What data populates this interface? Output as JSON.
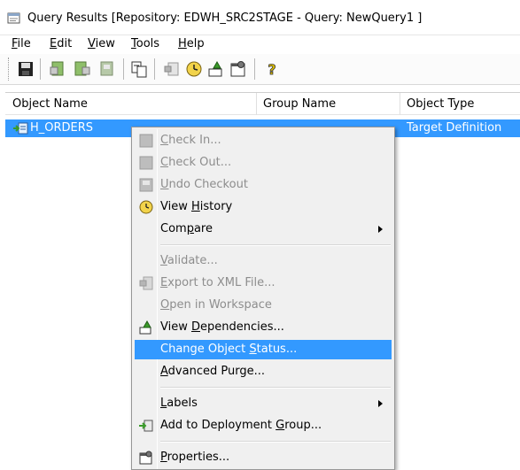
{
  "window": {
    "title": "Query Results [Repository: EDWH_SRC2STAGE - Query: NewQuery1 ]"
  },
  "menubar": {
    "items": [
      {
        "label": "File",
        "mnemonic": "F",
        "rest": "ile"
      },
      {
        "label": "Edit",
        "mnemonic": "E",
        "rest": "dit"
      },
      {
        "label": "View",
        "mnemonic": "V",
        "rest": "iew"
      },
      {
        "label": "Tools",
        "mnemonic": "T",
        "rest": "ools"
      },
      {
        "label": "Help",
        "mnemonic": "H",
        "rest": "elp"
      }
    ]
  },
  "toolbar": {
    "icons": [
      "save-icon",
      "check-in-icon",
      "check-out-icon",
      "undo-checkout-icon",
      "compare-icon",
      "export-icon",
      "view-history-icon",
      "dependencies-icon",
      "properties-icon",
      "help-icon"
    ]
  },
  "table": {
    "columns": [
      "Object Name",
      "Group Name",
      "Object Type"
    ],
    "rows": [
      {
        "name": "H_ORDERS",
        "group": "",
        "type": "Target Definition",
        "selected": true
      }
    ]
  },
  "context_menu": {
    "items": [
      {
        "pre": "",
        "key": "C",
        "post": "heck In...",
        "label": "Check In...",
        "enabled": false,
        "icon": "check-in-icon"
      },
      {
        "pre": "",
        "key": "C",
        "post": "heck Out...",
        "label": "Check Out...",
        "enabled": false,
        "icon": "check-out-icon"
      },
      {
        "pre": "",
        "key": "U",
        "post": "ndo Checkout",
        "label": "Undo Checkout",
        "enabled": false,
        "icon": "undo-checkout-icon"
      },
      {
        "pre": "View ",
        "key": "H",
        "post": "istory",
        "label": "View History",
        "enabled": true,
        "icon": "view-history-icon"
      },
      {
        "pre": "Com",
        "key": "p",
        "post": "are",
        "label": "Compare",
        "enabled": true,
        "submenu": true
      },
      {
        "pre": "",
        "key": "V",
        "post": "alidate...",
        "label": "Validate...",
        "enabled": false
      },
      {
        "pre": "",
        "key": "E",
        "post": "xport to XML File...",
        "label": "Export to XML File...",
        "enabled": false,
        "icon": "export-xml-icon"
      },
      {
        "pre": "",
        "key": "O",
        "post": "pen in Workspace",
        "label": "Open in Workspace",
        "enabled": false
      },
      {
        "pre": "View ",
        "key": "D",
        "post": "ependencies...",
        "label": "View Dependencies...",
        "enabled": true,
        "icon": "dependencies-icon"
      },
      {
        "pre": "Change Object ",
        "key": "S",
        "post": "tatus...",
        "label": "Change Object Status...",
        "enabled": true,
        "highlighted": true
      },
      {
        "pre": "",
        "key": "A",
        "post": "dvanced Purge...",
        "label": "Advanced Purge...",
        "enabled": true
      },
      {
        "pre": "",
        "key": "L",
        "post": "abels",
        "label": "Labels",
        "enabled": true,
        "submenu": true
      },
      {
        "pre": "Add to Deployment ",
        "key": "G",
        "post": "roup...",
        "label": "Add to Deployment Group...",
        "enabled": true,
        "icon": "deployment-group-icon"
      },
      {
        "pre": "",
        "key": "P",
        "post": "roperties...",
        "label": "Properties...",
        "enabled": true,
        "icon": "properties-icon"
      }
    ]
  },
  "colors": {
    "selection": "#3399ff",
    "menu_bg": "#f0f0f0",
    "disabled_text": "#8d8d8d"
  }
}
